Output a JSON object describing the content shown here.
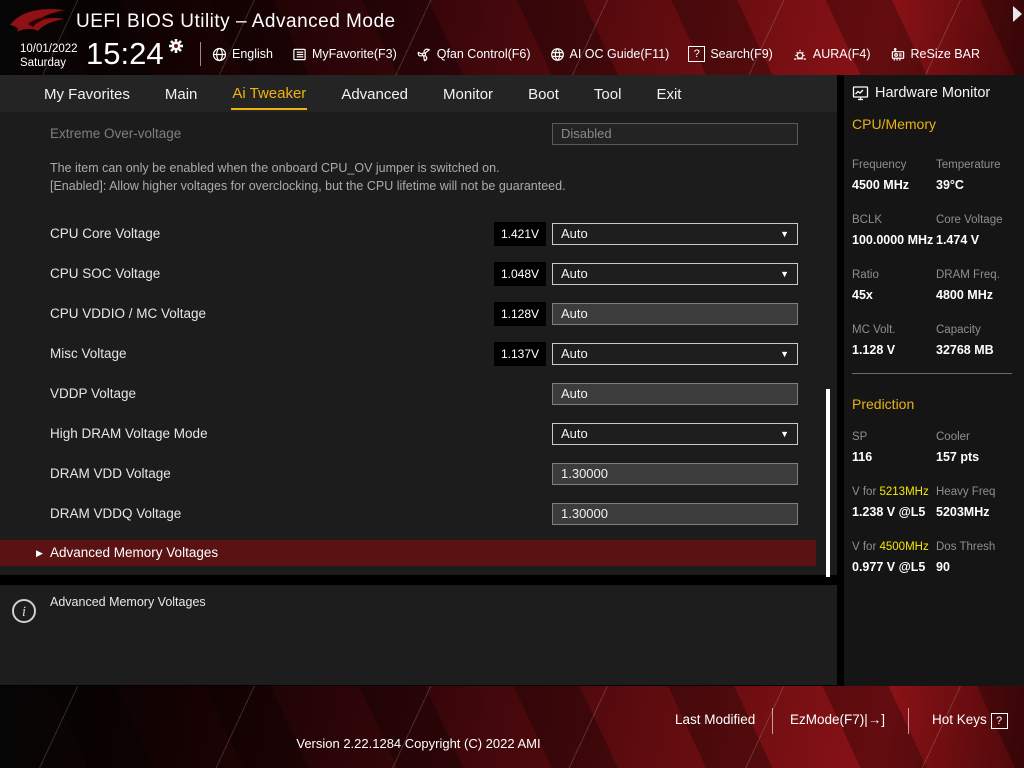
{
  "header": {
    "title": "UEFI BIOS Utility – Advanced Mode",
    "date": "10/01/2022",
    "day": "Saturday",
    "time": "15:24",
    "menu_items": [
      {
        "label": "English",
        "icon": "globe-icon"
      },
      {
        "label": "MyFavorite(F3)",
        "icon": "favorites-list-icon"
      },
      {
        "label": "Qfan Control(F6)",
        "icon": "fan-icon"
      },
      {
        "label": "AI OC Guide(F11)",
        "icon": "brain-icon"
      },
      {
        "label": "Search(F9)",
        "icon": "question-box-icon"
      },
      {
        "label": "AURA(F4)",
        "icon": "aura-lamp-icon"
      },
      {
        "label": "ReSize BAR",
        "icon": "gpu-card-icon"
      }
    ],
    "search_glyph": "?"
  },
  "nav": {
    "tabs": [
      "My Favorites",
      "Main",
      "Ai Tweaker",
      "Advanced",
      "Monitor",
      "Boot",
      "Tool",
      "Exit"
    ],
    "active_tab": "Ai Tweaker"
  },
  "content": {
    "disabled_row": {
      "label": "Extreme Over-voltage",
      "value": "Disabled"
    },
    "help_text": "The item can only be enabled when the onboard CPU_OV jumper is switched on.\n[Enabled]: Allow higher voltages for overclocking, but the CPU lifetime will not be guaranteed.",
    "rows": [
      {
        "label": "CPU Core Voltage",
        "badge": "1.421V",
        "value": "Auto",
        "control": "dropdown"
      },
      {
        "label": "CPU SOC Voltage",
        "badge": "1.048V",
        "value": "Auto",
        "control": "dropdown"
      },
      {
        "label": "CPU VDDIO / MC Voltage",
        "badge": "1.128V",
        "value": "Auto",
        "control": "textbox"
      },
      {
        "label": "Misc Voltage",
        "badge": "1.137V",
        "value": "Auto",
        "control": "dropdown"
      },
      {
        "label": "VDDP Voltage",
        "badge": "",
        "value": "Auto",
        "control": "textbox"
      },
      {
        "label": "High DRAM Voltage Mode",
        "badge": "",
        "value": "Auto",
        "control": "dropdown"
      },
      {
        "label": "DRAM VDD Voltage",
        "badge": "",
        "value": "1.30000",
        "control": "textbox"
      },
      {
        "label": "DRAM VDDQ Voltage",
        "badge": "",
        "value": "1.30000",
        "control": "textbox"
      }
    ],
    "dropdown_arrow": "▼",
    "submenu_row": {
      "arrow": "▶",
      "label": "Advanced Memory Voltages"
    },
    "info_panel": {
      "icon": "info-icon",
      "icon_glyph": "i",
      "text": "Advanced Memory Voltages"
    }
  },
  "sidebar": {
    "title": "Hardware Monitor",
    "cpu_memory": {
      "heading": "CPU/Memory",
      "pairs": [
        {
          "label": "Frequency",
          "value": "4500 MHz"
        },
        {
          "label": "Temperature",
          "value": "39°C"
        },
        {
          "label": "BCLK",
          "value": "100.0000 MHz"
        },
        {
          "label": "Core Voltage",
          "value": "1.474 V"
        },
        {
          "label": "Ratio",
          "value": "45x"
        },
        {
          "label": "DRAM Freq.",
          "value": "4800 MHz"
        },
        {
          "label": "MC Volt.",
          "value": "1.128 V"
        },
        {
          "label": "Capacity",
          "value": "32768 MB"
        }
      ]
    },
    "prediction": {
      "heading": "Prediction",
      "pairs": [
        {
          "label": "SP",
          "value": "116"
        },
        {
          "label": "Cooler",
          "value": "157 pts"
        },
        {
          "label_prefix": "V for ",
          "label_highlight": "5213MHz",
          "value": "1.238 V @L5"
        },
        {
          "label": "Heavy Freq",
          "value": "5203MHz"
        },
        {
          "label_prefix": "V for ",
          "label_highlight": "4500MHz",
          "value": "0.977 V @L5"
        },
        {
          "label": "Dos Thresh",
          "value": "90"
        }
      ]
    }
  },
  "footer": {
    "last_modified": "Last Modified",
    "ezmode": "EzMode(F7)",
    "ezmode_icon_glyph": "|→]",
    "hot_keys": "Hot Keys",
    "hot_keys_badge": "?",
    "version": "Version 2.22.1284 Copyright (C) 2022 AMI"
  },
  "colors": {
    "accent_gold": "#eeb211",
    "highlight_yellow": "#f6e600",
    "submenu_highlight": "#5a1213",
    "panel_bg": "#1c1c1c",
    "band_red": "#670d10"
  }
}
